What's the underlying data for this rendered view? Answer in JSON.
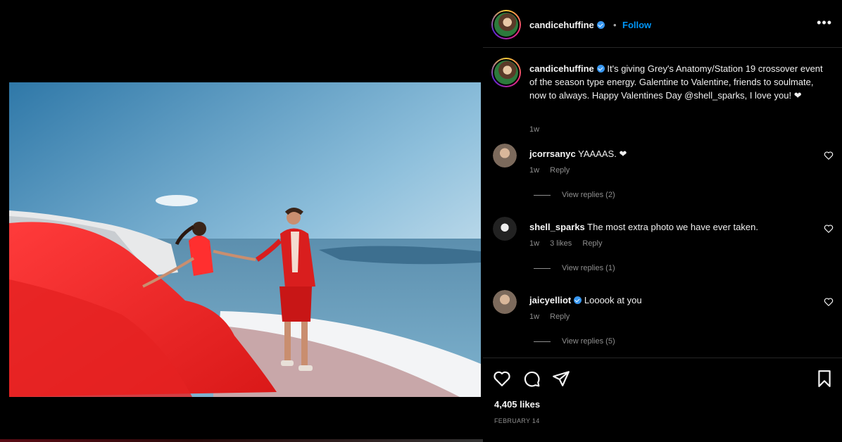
{
  "post": {
    "username": "candicehuffine",
    "follow_label": "Follow",
    "separator": "•",
    "more_icon": "more-horizontal-icon",
    "image_alt": "Woman in flowing red dress holding hands with person in red suit on a white terrace overlooking the sea"
  },
  "caption": {
    "username": "candicehuffine",
    "text": "It's giving Grey's Anatomy/Station 19 crossover event of the season type energy. Galentine to Valentine, friends to soulmate, now to always. Happy Valentines Day @shell_sparks, I love you! ❤",
    "time": "1w"
  },
  "comments": [
    {
      "username": "jcorrsanyc",
      "text": "YAAAAS. ❤",
      "time": "1w",
      "likes": "",
      "reply": "Reply",
      "view_replies": "View replies (2)"
    },
    {
      "username": "shell_sparks",
      "text": "The most extra photo we have ever taken.",
      "time": "1w",
      "likes": "3 likes",
      "reply": "Reply",
      "view_replies": "View replies (1)"
    },
    {
      "username": "jaicyelliot",
      "text": "Looook at you",
      "time": "1w",
      "likes": "",
      "reply": "Reply",
      "view_replies": "View replies (5)"
    }
  ],
  "actions": {
    "likes": "4,405 likes",
    "date": "FEBRUARY 14"
  },
  "colors": {
    "background": "#000000",
    "accent": "#0095f6",
    "verified": "#3897f0",
    "heart": "#ed4956"
  }
}
